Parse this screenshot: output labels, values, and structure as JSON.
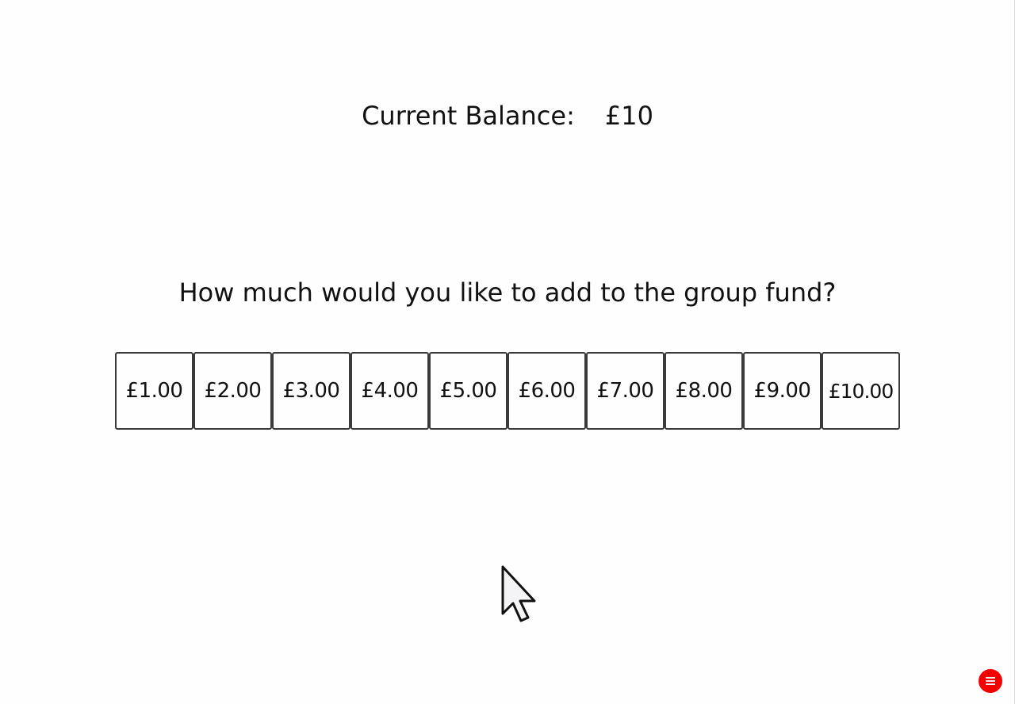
{
  "balance": {
    "label": "Current Balance:",
    "value": "£10"
  },
  "question": "How much would you like to add to the group fund?",
  "amounts": [
    "£1.00",
    "£2.00",
    "£3.00",
    "£4.00",
    "£5.00",
    "£6.00",
    "£7.00",
    "£8.00",
    "£9.00",
    "£10.00"
  ],
  "icons": {
    "cursor": "mouse-pointer-icon",
    "menu": "hamburger-menu-icon"
  },
  "colors": {
    "menu_button": "#f50000",
    "button_border": "#3a3a3a"
  }
}
